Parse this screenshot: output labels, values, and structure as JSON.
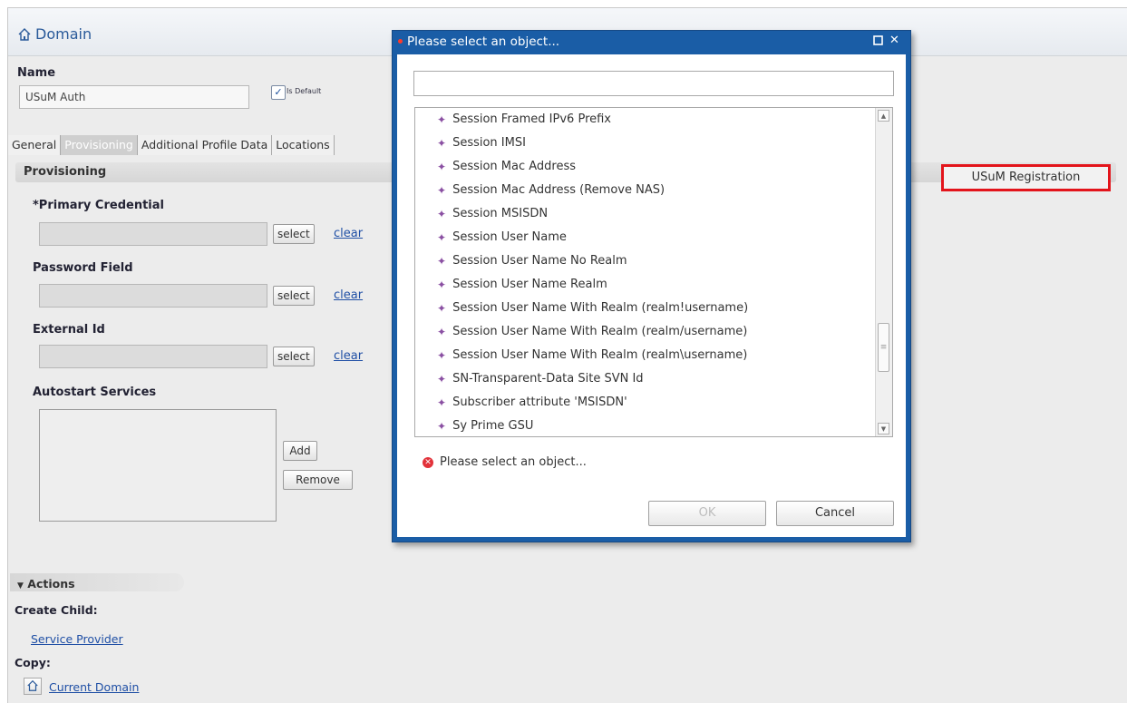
{
  "page": {
    "title": "Domain",
    "name_label": "Name",
    "name_value": "USuM Auth",
    "is_default_label": "Is Default",
    "is_default_checked": true
  },
  "tabs": [
    "General",
    "Provisioning",
    "Additional Profile Data",
    "Locations"
  ],
  "active_tab": "Provisioning",
  "provisioning": {
    "section_title": "Provisioning",
    "primary_credential_label": "*Primary Credential",
    "password_field_label": "Password Field",
    "external_id_label": "External Id",
    "autostart_label": "Autostart Services",
    "select_label": "select",
    "clear_label": "clear",
    "add_label": "Add",
    "remove_label": "Remove"
  },
  "side_button": {
    "label": "USuM Registration"
  },
  "actions": {
    "title": "Actions",
    "create_child_label": "Create Child:",
    "service_provider_link": "Service Provider",
    "copy_label": "Copy:",
    "current_domain_link": "Current Domain"
  },
  "modal": {
    "title": "Please select an object...",
    "search_value": "",
    "items": [
      "Session Framed IPv6 Prefix",
      "Session IMSI",
      "Session Mac Address",
      "Session Mac Address (Remove NAS)",
      "Session MSISDN",
      "Session User Name",
      "Session User Name No Realm",
      "Session User Name Realm",
      "Session User Name With Realm (realm!username)",
      "Session User Name With Realm (realm/username)",
      "Session User Name With Realm (realm\\username)",
      "SN-Transparent-Data Site SVN Id",
      "Subscriber attribute 'MSISDN'",
      "Sy Prime GSU"
    ],
    "error_text": "Please select an object...",
    "ok_label": "OK",
    "cancel_label": "Cancel"
  },
  "colors": {
    "modal_titlebar": "#1a5da6",
    "highlight_border": "#e3141b",
    "link": "#1f4fa5",
    "item_icon": "#8a4fa2"
  },
  "icons": {
    "home": "home-icon",
    "item": "diamond-icon",
    "error": "error-icon",
    "maximize": "maximize-icon",
    "close": "close-icon"
  }
}
